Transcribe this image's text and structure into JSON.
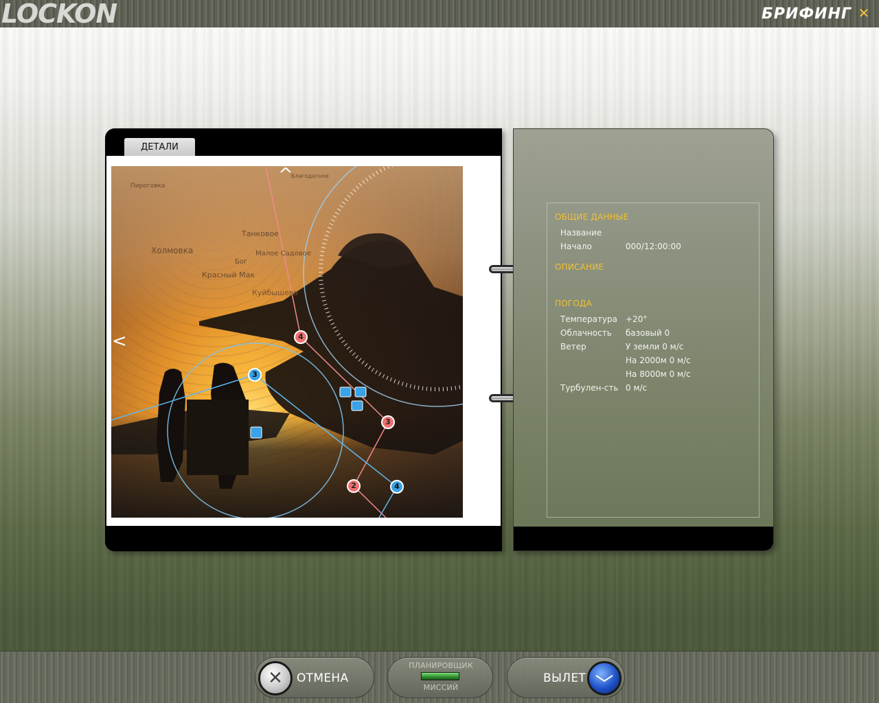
{
  "app": {
    "logo": "LOCKON",
    "screen_title": "БРИФИНГ"
  },
  "left_panel": {
    "tab_label": "ДЕТАЛИ",
    "map_labels": [
      "Пироговка",
      "Танковое",
      "Холмовка",
      "Малое Садовое",
      "Бог",
      "Красный Мак",
      "Куйбышево",
      "Благодатное"
    ],
    "waypoints_red": [
      "4",
      "3",
      "2"
    ],
    "waypoints_blue": [
      "3",
      "4"
    ]
  },
  "right_panel": {
    "general": {
      "title": "ОБЩИЕ ДАННЫЕ",
      "name_label": "Название",
      "name_value": "",
      "start_label": "Начало",
      "start_value": "000/12:00:00"
    },
    "description": {
      "title": "ОПИСАНИЕ",
      "text": ""
    },
    "weather": {
      "title": "ПОГОДА",
      "temp_label": "Температура",
      "temp_value": "+20°",
      "clouds_label": "Облачность",
      "clouds_value": "базовый 0",
      "wind_label": "Ветер",
      "wind_ground": "У земли 0 м/с",
      "wind_2000": "На 2000м 0 м/с",
      "wind_8000": "На 8000м 0 м/с",
      "turb_label": "Турбулен-сть",
      "turb_value": "0 м/с"
    }
  },
  "bottom": {
    "cancel_label": "ОТМЕНА",
    "planner_top": "ПЛАНИРОВЩИК",
    "planner_bottom": "МИССИЙ",
    "fly_label": "ВЫЛЕТ"
  },
  "colors": {
    "accent_yellow": "#f1c232",
    "waypoint_red": "#f07070",
    "waypoint_blue": "#3aa2e6"
  }
}
